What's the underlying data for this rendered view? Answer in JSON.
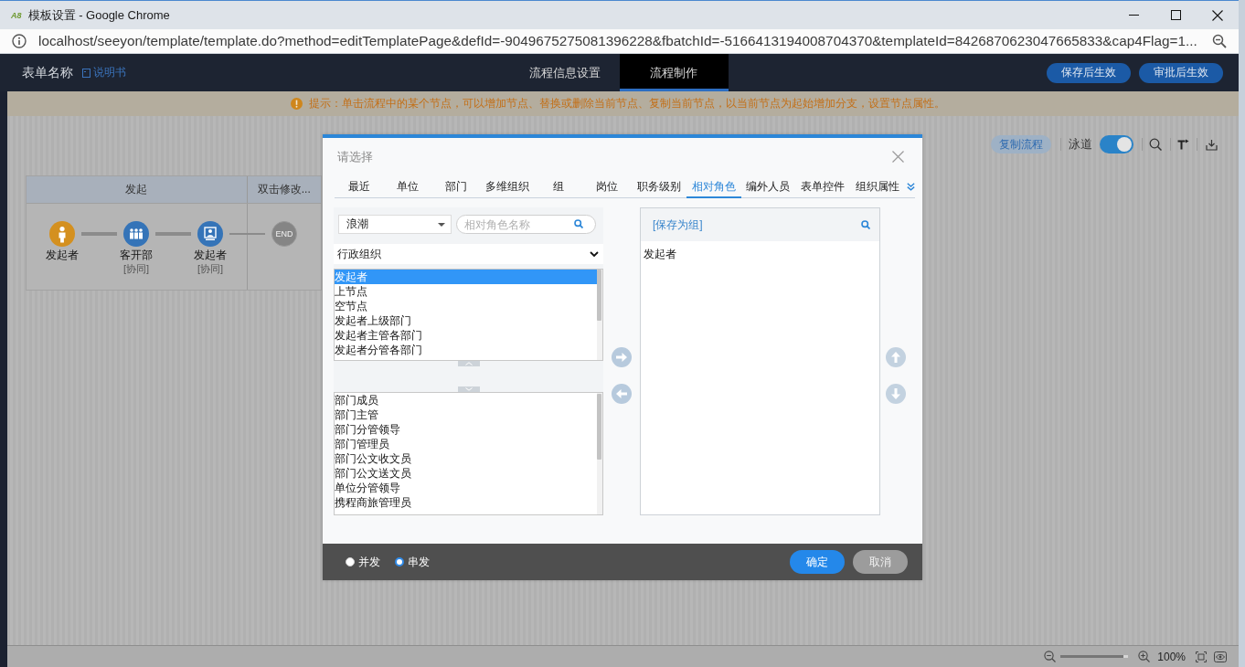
{
  "browser": {
    "logo": "A8",
    "title": "模板设置 - Google Chrome",
    "url": "localhost/seeyon/template/template.do?method=editTemplatePage&defId=-9049675275081396228&fbatchId=-5166413194008704370&templateId=8426870623047665833&cap4Flag=1..."
  },
  "header": {
    "form_name": "表单名称",
    "manual_link": "说明书",
    "tabs": [
      {
        "label": "流程信息设置",
        "selected": false
      },
      {
        "label": "流程制作",
        "selected": true
      }
    ],
    "buttons": [
      "保存后生效",
      "审批后生效"
    ]
  },
  "notice": "提示：单击流程中的某个节点，可以增加节点、替换或删除当前节点、复制当前节点，以当前节点为起始增加分支，设置节点属性。",
  "toolbar": {
    "copy_button": "复制流程",
    "swimlane": {
      "label": "泳道",
      "on": true
    }
  },
  "swimlanes": [
    {
      "title": "发起"
    },
    {
      "title": "双击修改..."
    }
  ],
  "nodes": [
    {
      "kind": "start",
      "label": "发起者"
    },
    {
      "kind": "department",
      "label": "客开部",
      "note": "[协同]"
    },
    {
      "kind": "person",
      "label": "发起者",
      "note": "[协同]"
    },
    {
      "kind": "end",
      "label": "END"
    }
  ],
  "zoom": {
    "level": 0.93,
    "reading": "100%"
  },
  "dialog": {
    "title": "请选择",
    "tabs": [
      {
        "label": "最近",
        "selected": false
      },
      {
        "label": "单位",
        "selected": false
      },
      {
        "label": "部门",
        "selected": false
      },
      {
        "label": "多维组织",
        "selected": false
      },
      {
        "label": "组",
        "selected": false
      },
      {
        "label": "岗位",
        "selected": false
      },
      {
        "label": "职务级别",
        "selected": false
      },
      {
        "label": "相对角色",
        "selected": true
      },
      {
        "label": "编外人员",
        "selected": false
      },
      {
        "label": "表单控件",
        "selected": false
      },
      {
        "label": "组织属性",
        "selected": false
      }
    ],
    "org_select": "浪潮",
    "search": {
      "placeholder": "相对角色名称"
    },
    "org_type": "行政组织",
    "roles_upper": [
      {
        "label": "发起者",
        "selected": true
      },
      {
        "label": "上节点",
        "selected": false
      },
      {
        "label": "空节点",
        "selected": false
      },
      {
        "label": "发起者上级部门",
        "selected": false
      },
      {
        "label": "发起者主管各部门",
        "selected": false
      },
      {
        "label": "发起者分管各部门",
        "selected": false
      }
    ],
    "roles_lower": [
      {
        "label": "部门成员",
        "selected": false
      },
      {
        "label": "部门主管",
        "selected": false
      },
      {
        "label": "部门分管领导",
        "selected": false
      },
      {
        "label": "部门管理员",
        "selected": false
      },
      {
        "label": "部门公文收文员",
        "selected": false
      },
      {
        "label": "部门公文送文员",
        "selected": false
      },
      {
        "label": "单位分管领导",
        "selected": false
      },
      {
        "label": "携程商旅管理员",
        "selected": false
      }
    ],
    "save_group": "[保存为组]",
    "selected_items": [
      "发起者"
    ],
    "modes": [
      {
        "label": "并发",
        "selected": false
      },
      {
        "label": "串发",
        "selected": true
      }
    ],
    "buttons": [
      {
        "label": "确定",
        "kind": "primary"
      },
      {
        "label": "取消",
        "kind": "secondary"
      }
    ]
  }
}
